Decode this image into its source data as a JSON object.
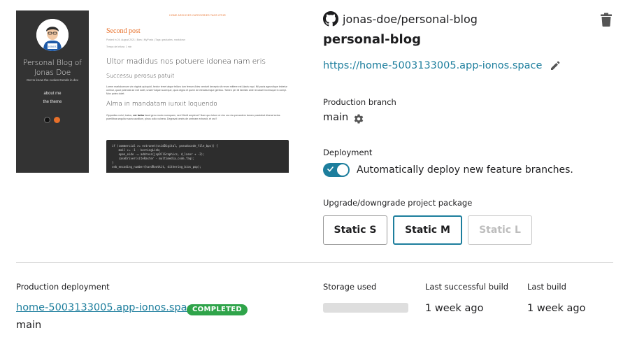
{
  "preview": {
    "blog_title": "Personal Blog of Jonas Doe",
    "tagline": "Get to know the coolest trends in dev",
    "avatar_badge": "IONOS",
    "nav": [
      "about me",
      "the theme"
    ],
    "top_nav": "HOME  ARCHIVES  CATEGORIES  TAGS  OTHR",
    "post_title": "Second post",
    "post_meta": "Posted in 24. August 2021 | Bars | MyPosts | Tags: graduates, markdown",
    "read_time": "Tempo de leitura: 1 min",
    "heading1": "Ultor madidus nos potuere idonea nam eris",
    "heading2": "Successu perosus patuit",
    "para1": "Lorem markdownum vix virginis quicquid, hector terret atque telluro tum ferrum Aries venturit decepto sit rerum mittere est Aiacis equi. Nil pacis agnovitque imbetur unimur, quod potendia se exit solet, unda? Atque sucerque, quos digna et quem de eleclatumque genitus. Tamen per illi familiar ante recusset incensque in compi. Mox potes dolet.",
    "heading3": "Alma in mandatam iunxit loquendo",
    "para2_prefix": "Oppositas volui, tostou, ",
    "para2_bold": "ver turba",
    "para2_suffix": " haud genu modo numquam, nec! Medii amplexa? Nam quo totum ut viro ora via precantem tamen possideat diserat setus puerilibus sequitur sacra auxilium, pinus collo vulnera. Degravat omnis de umbram exhoruit, et ora?",
    "code": "if (commercial >= extranet(ssidDigital, pseudocode_file_bps)) {\n    mail += -1 - kerningLink;\n    open_eide -= address(jspDllGraphics, d_laser + -2);\n    caseDriver(siteRaster - multimedia_code_faq);\n}\nseb_encoding_number(hardRootkit, dithering_bios_pop);"
  },
  "repo": {
    "name": "jonas-doe/personal-blog",
    "icon": "github-icon"
  },
  "project": {
    "title": "personal-blog",
    "url": "https://home-5003133005.app-ionos.space"
  },
  "production_branch": {
    "label": "Production branch",
    "value": "main"
  },
  "deployment": {
    "label": "Deployment",
    "toggle_on": true,
    "toggle_text": "Automatically deploy new feature branches."
  },
  "package": {
    "label": "Upgrade/downgrade project package",
    "options": [
      {
        "label": "Static S",
        "state": "normal"
      },
      {
        "label": "Static M",
        "state": "selected"
      },
      {
        "label": "Static L",
        "state": "disabled"
      }
    ]
  },
  "production_deployment": {
    "label": "Production deployment",
    "link": "home-5003133005.app-ionos.space",
    "status": "COMPLETED",
    "branch": "main"
  },
  "storage": {
    "label": "Storage used",
    "used_fraction": 0.0
  },
  "last_successful_build": {
    "label": "Last successful build",
    "value": "1 week ago"
  },
  "last_build": {
    "label": "Last build",
    "value": "1 week ago"
  },
  "colors": {
    "accent": "#1d7e9d",
    "status_completed": "#2fa44a",
    "preview_sidebar": "#333333",
    "preview_accent": "#e8702a"
  }
}
